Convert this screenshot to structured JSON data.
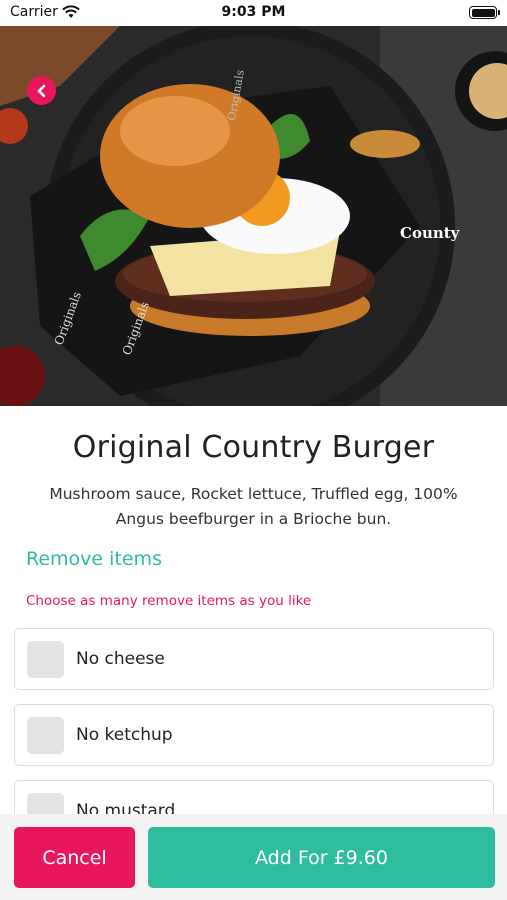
{
  "status_bar": {
    "carrier": "Carrier",
    "time": "9:03 PM"
  },
  "hero": {
    "image_description_icon": "burger-photo",
    "brand_text": "County",
    "wrapper_text": "Originals"
  },
  "product": {
    "title": "Original Country Burger",
    "description": "Mushroom sauce, Rocket lettuce, Truffled egg, 100% Angus beefburger in a Brioche bun."
  },
  "remove_section": {
    "title": "Remove items",
    "hint": "Choose as many remove items as you like",
    "options": [
      {
        "label": "No cheese",
        "checked": false
      },
      {
        "label": "No ketchup",
        "checked": false
      },
      {
        "label": "No mustard",
        "checked": false
      }
    ]
  },
  "actions": {
    "cancel_label": "Cancel",
    "add_label": "Add For £9.60"
  },
  "colors": {
    "accent_pink": "#e8175d",
    "accent_teal": "#2ebd9f"
  }
}
